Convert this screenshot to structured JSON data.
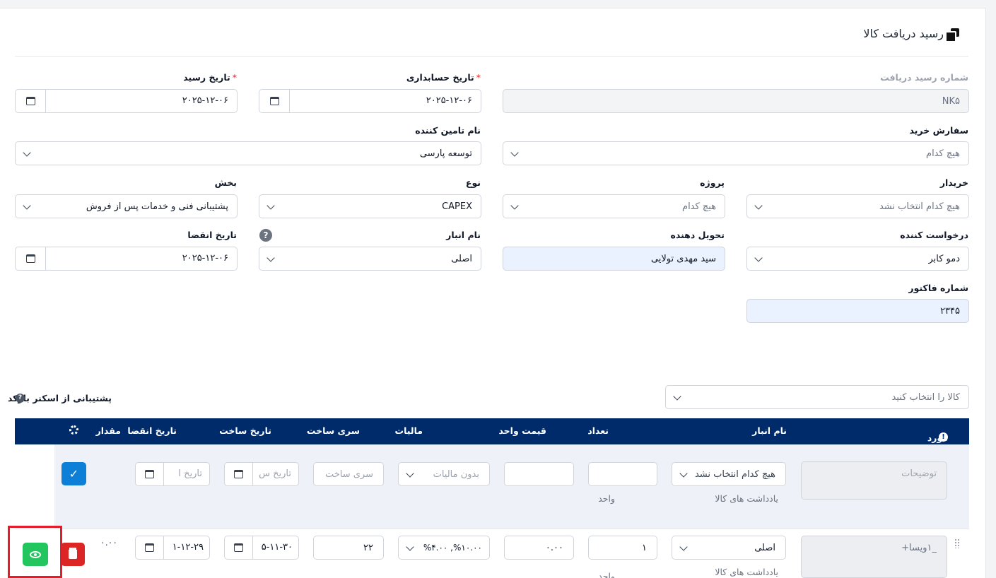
{
  "header": {
    "title": "رسید دریافت کالا"
  },
  "form": {
    "receipt_no": {
      "label": "شماره رسید دریافت",
      "value": "NK۵"
    },
    "accounting_date": {
      "label": "تاریخ حسابداری",
      "required": "*",
      "value": "۲۰۲۵-۱۲-۰۶"
    },
    "receipt_date": {
      "label": "تاریخ رسید",
      "required": "*",
      "value": "۲۰۲۵-۱۲-۰۶"
    },
    "purchase_order": {
      "label": "سفارش خرید",
      "value": "هیچ کدام"
    },
    "supplier": {
      "label": "نام تامین کننده",
      "value": "توسعه پارسی"
    },
    "buyer": {
      "label": "خریدار",
      "value": "هیچ کدام انتخاب نشد"
    },
    "project": {
      "label": "پروژه",
      "value": "هیچ کدام"
    },
    "type": {
      "label": "نوع",
      "value": "CAPEX"
    },
    "department": {
      "label": "بخش",
      "value": "پشتیبانی فنی و خدمات پس از فروش"
    },
    "requester": {
      "label": "درخواست کننده",
      "value": "دمو کابر"
    },
    "deliverer": {
      "label": "تحویل دهنده",
      "value": "سید مهدی تولایی"
    },
    "warehouse": {
      "label": "نام انبار",
      "value": "اصلی",
      "help": "?"
    },
    "expiry_date": {
      "label": "تاریخ انقضا",
      "value": "۲۰۲۵-۱۲-۰۶"
    },
    "invoice_no": {
      "label": "شماره فاکتور",
      "value": "۲۳۴۵"
    }
  },
  "items": {
    "select_placeholder": "کالا را انتخاب کنید",
    "barcode_label": "پشتیبانی از اسکنر بارکد",
    "barcode_help": "?",
    "columns": {
      "item": "مورد",
      "warehouse": "نام انبار",
      "qty": "تعداد",
      "unit_price": "قیمت واحد",
      "tax": "مالیات",
      "batch": "سری ساخت",
      "mfg_date": "تاریخ ساخت",
      "expiry": "تاریخ انقضا",
      "amount": "مقدار"
    },
    "new_row": {
      "description_placeholder": "توضیحات",
      "warehouse_value": "هیچ کدام انتخاب نشد",
      "item_notes_label": "یادداشت های کالا",
      "unit_label": "واحد",
      "tax_value": "بدون مالیات",
      "batch_placeholder": "سری ساخت",
      "mfg_placeholder": "تاریخ س",
      "expiry_placeholder": "تاریخ ا"
    },
    "row1": {
      "description": "_۱ویسا+",
      "warehouse_value": "اصلی",
      "item_notes_label": "یادداشت های کالا",
      "unit_label": "واحد",
      "qty": "۱",
      "unit_price": "۰.۰۰",
      "tax_value": "%۴.۰۰ ,%۱۰.۰۰",
      "batch": "۲۲",
      "mfg_date": "۵-۱۱-۳۰",
      "expiry": "۱-۱۲-۲۹",
      "amount": "۰.۰۰"
    }
  }
}
